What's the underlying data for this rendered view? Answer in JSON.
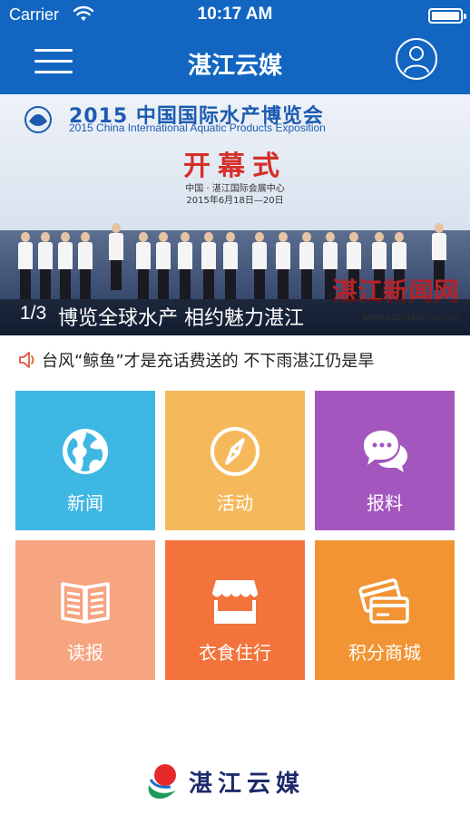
{
  "status_bar": {
    "carrier": "Carrier",
    "time": "10:17 AM",
    "battery_level": 1.0
  },
  "nav": {
    "title": "湛江云媒",
    "menu_icon": "hamburger-menu-icon",
    "user_icon": "user-avatar-icon",
    "bar_color": "#1266c2"
  },
  "banner": {
    "board_title": "2015 中国国际水产博览会",
    "board_subtitle": "2015 China International Aquatic Products Exposition",
    "ceremony": "开幕式",
    "venue": "中国 · 湛江国际会展中心",
    "date": "2015年6月18日—20日",
    "watermark": "湛江新闻网",
    "watermark_url": "www.gdzjdaily.com.cn",
    "index": "1/3",
    "caption": "博览全球水产 相约魅力湛江"
  },
  "ticker": {
    "icon": "speaker-icon",
    "text": "台风“鲸鱼”才是充话费送的 不下雨湛江仍是旱"
  },
  "tiles": [
    {
      "label": "新闻",
      "icon": "globe-icon",
      "color": "#3fb7e3"
    },
    {
      "label": "活动",
      "icon": "compass-icon",
      "color": "#f5b95c"
    },
    {
      "label": "报料",
      "icon": "chat-bubbles-icon",
      "color": "#a357be"
    },
    {
      "label": "读报",
      "icon": "newspaper-icon",
      "color": "#f7a481"
    },
    {
      "label": "衣食住行",
      "icon": "storefront-icon",
      "color": "#f2733b"
    },
    {
      "label": "积分商城",
      "icon": "cards-icon",
      "color": "#f29433"
    }
  ],
  "footer": {
    "logo_text": "湛江云媒"
  }
}
